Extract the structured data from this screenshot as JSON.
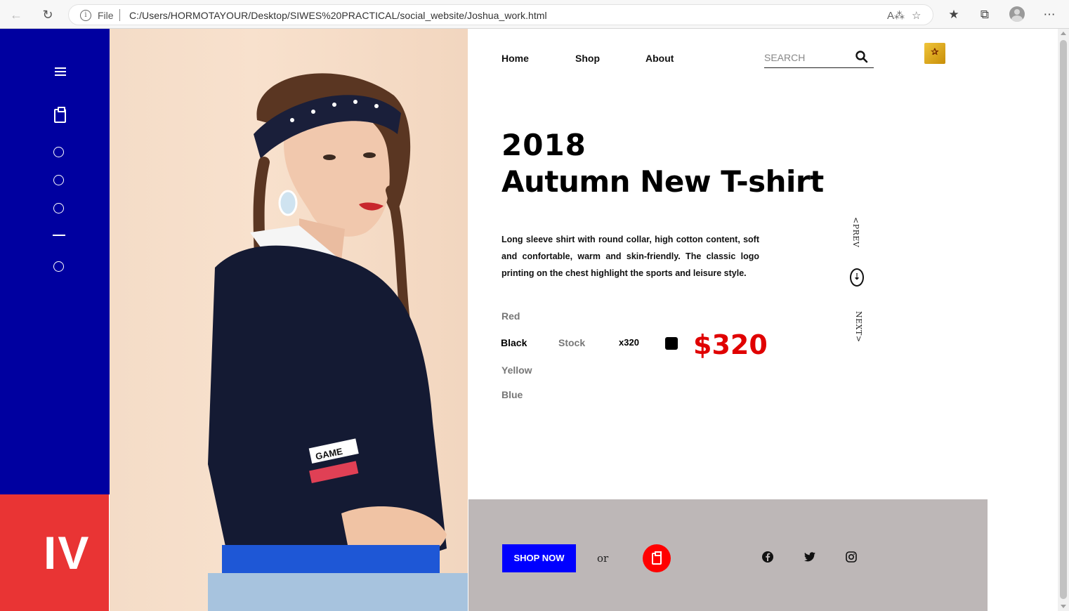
{
  "browser": {
    "file_label": "File",
    "url": "C:/Users/HORMOTAYOUR/Desktop/SIWES%20PRACTICAL/social_website/Joshua_work.html"
  },
  "nav": {
    "items": [
      "Home",
      "Shop",
      "About"
    ],
    "search_placeholder": "SEARCH"
  },
  "sidebar": {
    "logo_text": "IV"
  },
  "product": {
    "year": "2018",
    "name": "Autumn New T-shirt",
    "description": "Long sleeve shirt with round collar, high cotton content, soft and confortable, warm and skin-friendly. The classic logo printing on the chest highlight the sports and leisure style.",
    "colors": [
      "Red",
      "Black",
      "Yellow",
      "Blue"
    ],
    "selected_color": "Black",
    "stock_label": "Stock",
    "stock_count": "x320",
    "price": "$320",
    "prev_label": "<PREV",
    "next_label": "NEXT>"
  },
  "footer": {
    "shop_now_label": "SHOP NOW",
    "or_label": "or",
    "social": [
      "facebook-icon",
      "twitter-icon",
      "instagram-icon"
    ]
  },
  "colors": {
    "sidebar": "#0000a0",
    "logo_block": "#e93434",
    "price": "#e00000",
    "shop_button": "#0000ff",
    "cart_button": "#ff0000",
    "footer": "#bdb7b7"
  }
}
